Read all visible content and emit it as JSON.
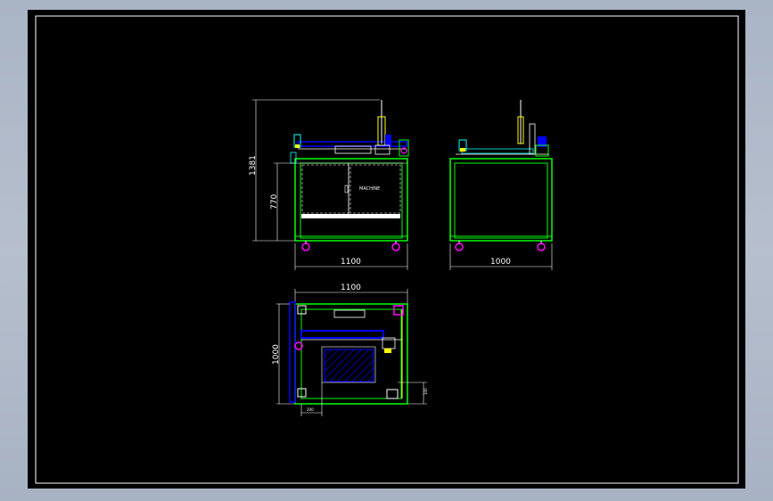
{
  "front_view": {
    "dim_total_height": "1381",
    "dim_cabinet_height": "770",
    "dim_width": "1100",
    "panel_label": "MACHINE"
  },
  "side_view": {
    "dim_width": "1000"
  },
  "top_view": {
    "dim_width": "1100",
    "dim_depth": "1000",
    "dim_offset_x": "200",
    "dim_offset_y": "100"
  },
  "colors": {
    "frame": "#00ff00",
    "dimension": "#ffffff",
    "accent_magenta": "#ff00ff",
    "accent_blue": "#0000ff",
    "accent_yellow": "#ffff00",
    "accent_cyan": "#00ffff"
  }
}
